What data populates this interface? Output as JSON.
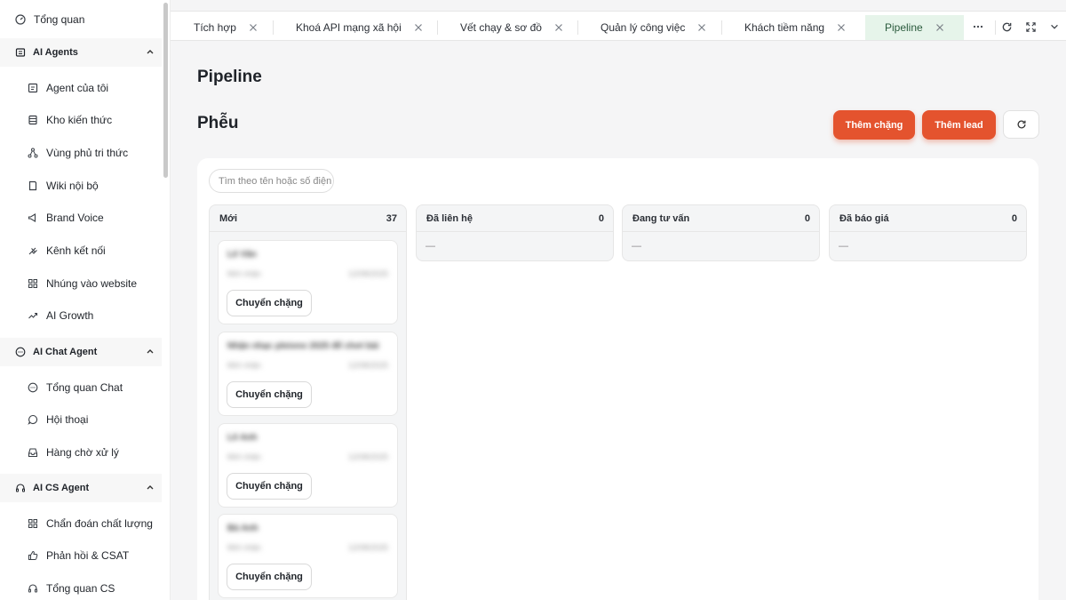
{
  "sidebar": {
    "overview": "Tổng quan",
    "groups": [
      {
        "label": "AI Agents",
        "items": [
          "Agent của tôi",
          "Kho kiến thức",
          "Vùng phủ tri thức",
          "Wiki nội bộ",
          "Brand Voice",
          "Kênh kết nối",
          "Nhúng vào website",
          "AI Growth"
        ]
      },
      {
        "label": "AI Chat Agent",
        "items": [
          "Tổng quan Chat",
          "Hội thoại",
          "Hàng chờ xử lý"
        ]
      },
      {
        "label": "AI CS Agent",
        "items": [
          "Chẩn đoán chất lượng",
          "Phản hồi & CSAT",
          "Tổng quan CS"
        ]
      }
    ]
  },
  "tabs": [
    "Tích hợp",
    "Khoá API mạng xã hội",
    "Vết chạy & sơ đồ",
    "Quản lý công việc",
    "Khách tiềm năng",
    "Pipeline"
  ],
  "active_tab": "Pipeline",
  "page": {
    "title": "Pipeline",
    "section_title": "Phễu",
    "add_stage_label": "Thêm chặng",
    "add_lead_label": "Thêm lead",
    "search_placeholder": "Tìm theo tên hoặc số điện thoại"
  },
  "columns": [
    {
      "title": "Mới",
      "count": "37"
    },
    {
      "title": "Đã liên hệ",
      "count": "0",
      "empty": "—"
    },
    {
      "title": "Đang tư vấn",
      "count": "0",
      "empty": "—"
    },
    {
      "title": "Đã báo giá",
      "count": "0",
      "empty": "—"
    }
  ],
  "cards": [
    {
      "name": "Lê Văn",
      "sub": "Mới nhận",
      "date": "12/08/2025",
      "action": "Chuyển chặng"
    },
    {
      "name": "Nhận nhạc pleiono 2025 để chơi bài",
      "sub": "Mới nhận",
      "date": "12/08/2025",
      "action": "Chuyển chặng"
    },
    {
      "name": "Lê Anh",
      "sub": "Mới nhận",
      "date": "12/08/2025",
      "action": "Chuyển chặng"
    },
    {
      "name": "Bá Anh",
      "sub": "Mới nhận",
      "date": "12/08/2025",
      "action": "Chuyển chặng"
    }
  ],
  "colors": {
    "accent": "#e4532e",
    "active_tab_bg": "#e6f4ea",
    "page_bg": "#f5f5f6"
  }
}
